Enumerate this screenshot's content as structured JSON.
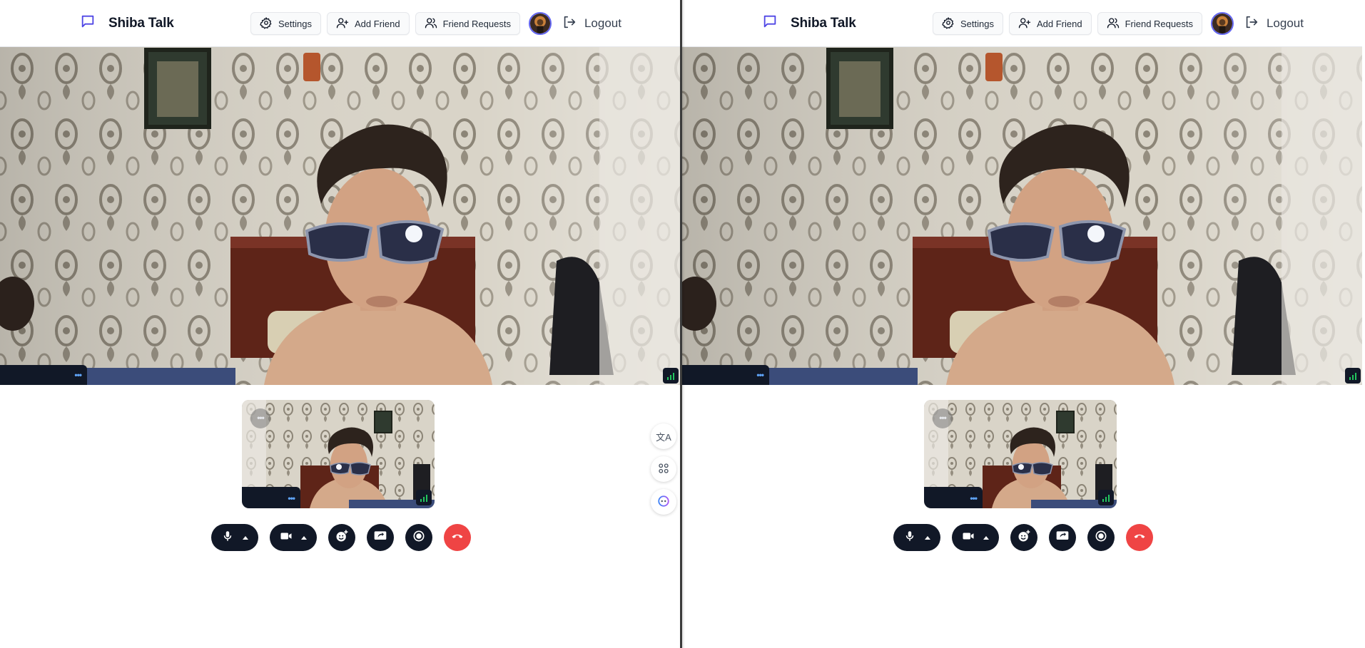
{
  "app": {
    "name": "Shiba Talk",
    "accent": "#4f46e5",
    "end_call_color": "#ef4444",
    "toolbar_color": "#111827"
  },
  "nav": {
    "settings": "Settings",
    "add_friend": "Add Friend",
    "friend_requests": "Friend Requests",
    "logout": "Logout"
  },
  "icons": {
    "brand": "chat-bubble-icon",
    "settings": "gear-icon",
    "add_friend": "user-plus-icon",
    "friend_requests": "users-icon",
    "logout": "logout-icon",
    "mic": "microphone-icon",
    "camera": "video-camera-icon",
    "reaction": "emoji-add-icon",
    "screen_share": "screen-share-icon",
    "record": "record-icon",
    "end_call": "phone-hangup-icon",
    "translate": "translate-icon",
    "apps": "command-icon",
    "assistant": "assistant-icon"
  },
  "video": {
    "more_label": "•••",
    "signal_bars": 3
  },
  "side_tools": {
    "translate_label": "文A"
  }
}
